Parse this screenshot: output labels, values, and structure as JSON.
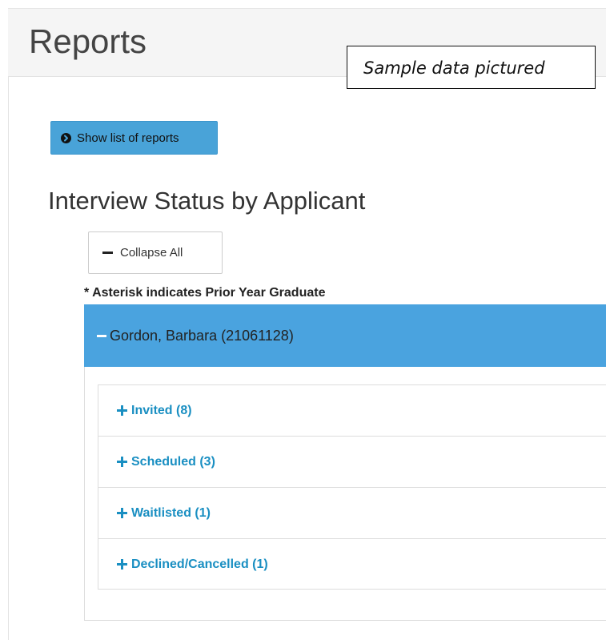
{
  "page": {
    "title": "Reports"
  },
  "annotation": {
    "sample_note": "Sample data pictured"
  },
  "toolbar": {
    "show_reports_label": "Show list of reports"
  },
  "report": {
    "title": "Interview Status by Applicant",
    "collapse_all_label": "Collapse All",
    "asterisk_note": "* Asterisk indicates Prior Year Graduate",
    "applicant": {
      "header": "Gordon, Barbara (21061128)",
      "statuses": [
        {
          "label": "Invited (8)"
        },
        {
          "label": "Scheduled (3)"
        },
        {
          "label": "Waitlisted (1)"
        },
        {
          "label": "Declined/Cancelled (1)"
        }
      ]
    }
  },
  "colors": {
    "accent_blue": "#4aa3df",
    "link_blue": "#1a8fc2",
    "header_bg": "#f5f5f5"
  },
  "icons": {
    "show_reports": "chevron-circle-right-icon",
    "collapse_all": "minus-icon",
    "applicant_toggle": "minus-icon",
    "status_toggle": "plus-icon"
  }
}
